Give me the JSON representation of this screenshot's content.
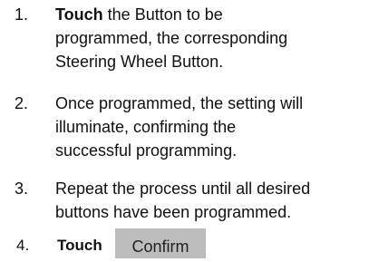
{
  "steps": [
    {
      "number": "1.",
      "bold_lead": "Touch",
      "text_lines": [
        "the Button to be",
        "programmed, the corresponding",
        "Steering Wheel Button."
      ]
    },
    {
      "number": "2.",
      "text_lines": [
        "Once programmed, the setting will",
        "illuminate, confirming the",
        "successful programming."
      ]
    },
    {
      "number": "3.",
      "text_lines": [
        "Repeat the process until all desired",
        "buttons have been programmed."
      ]
    },
    {
      "number": "4.",
      "bold_lead": "Touch",
      "button_label": "Confirm"
    }
  ],
  "colors": {
    "button_background": "#bdbdbd",
    "text": "#111111"
  }
}
